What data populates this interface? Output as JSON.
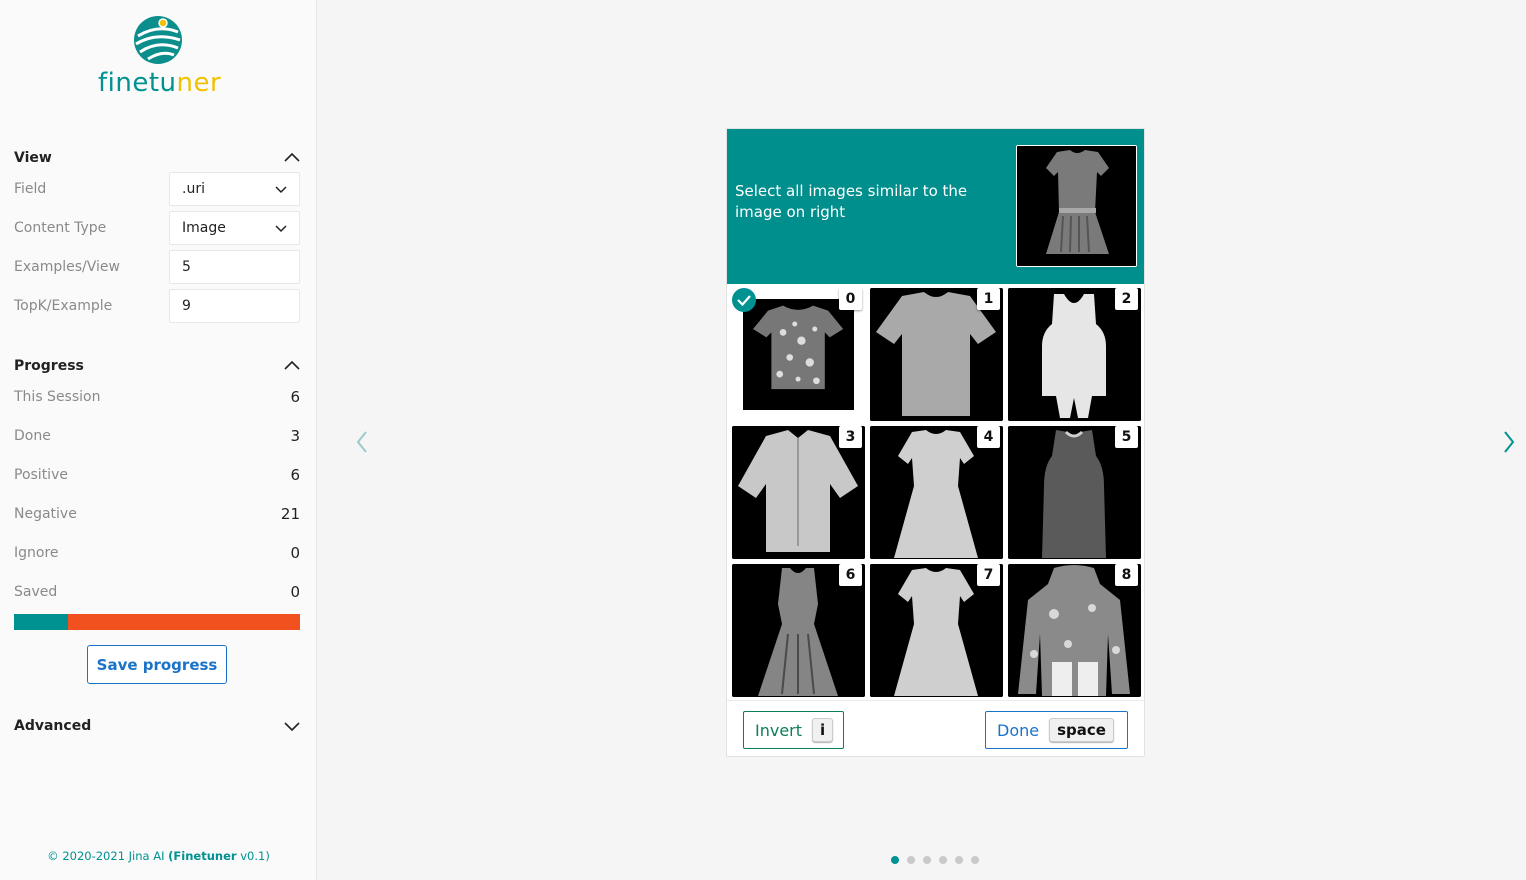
{
  "app": {
    "logo_text_a": "fine",
    "logo_text_b": "tu",
    "logo_text_c": "ner"
  },
  "view": {
    "title": "View",
    "field_label": "Field",
    "field_value": ".uri",
    "content_type_label": "Content Type",
    "content_type_value": "Image",
    "examples_label": "Examples/View",
    "examples_value": "5",
    "topk_label": "TopK/Example",
    "topk_value": "9"
  },
  "progress": {
    "title": "Progress",
    "this_session_label": "This Session",
    "this_session_value": "6",
    "done_label": "Done",
    "done_value": "3",
    "positive_label": "Positive",
    "positive_value": "6",
    "negative_label": "Negative",
    "negative_value": "21",
    "ignore_label": "Ignore",
    "ignore_value": "0",
    "saved_label": "Saved",
    "saved_value": "0",
    "bar_positive_fraction": 0.19,
    "positive_color": "#009191",
    "negative_color": "#f0511f",
    "save_button": "Save progress"
  },
  "advanced": {
    "title": "Advanced"
  },
  "footer": {
    "copyright": "© 2020-2021 Jina AI ",
    "product": "(Finetuner",
    "version": " v0.1)"
  },
  "card": {
    "instruction": "Select all images similar to the image on right",
    "tiles": [
      {
        "index": "0",
        "selected": true,
        "garment": "tshirt-pattern"
      },
      {
        "index": "1",
        "selected": false,
        "garment": "tshirt"
      },
      {
        "index": "2",
        "selected": false,
        "garment": "tank"
      },
      {
        "index": "3",
        "selected": false,
        "garment": "shirt"
      },
      {
        "index": "4",
        "selected": false,
        "garment": "dress"
      },
      {
        "index": "5",
        "selected": false,
        "garment": "tank-dark"
      },
      {
        "index": "6",
        "selected": false,
        "garment": "dress-sleeveless"
      },
      {
        "index": "7",
        "selected": false,
        "garment": "dress"
      },
      {
        "index": "8",
        "selected": false,
        "garment": "jacket"
      }
    ],
    "invert_label": "Invert",
    "invert_key": "i",
    "done_label": "Done",
    "done_key": "space"
  },
  "pager": {
    "count": 6,
    "active": 0
  },
  "colors": {
    "accent": "#009191",
    "header": "#008f8c",
    "link": "#1a73c8"
  }
}
